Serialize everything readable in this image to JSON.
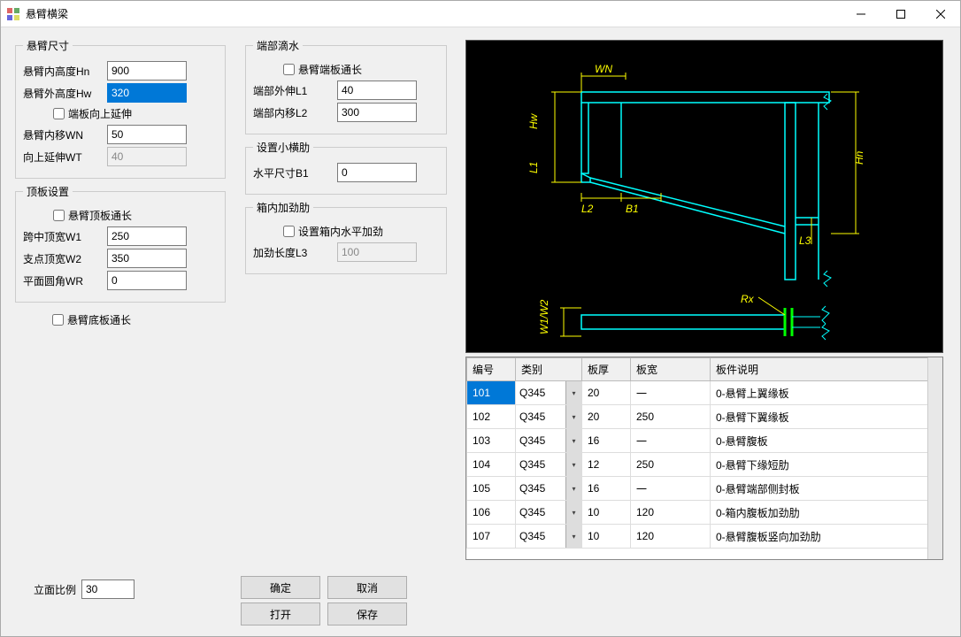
{
  "window": {
    "title": "悬臂横梁"
  },
  "winbtns": {
    "close_tip": "Close"
  },
  "arm_size": {
    "legend": "悬臂尺寸",
    "hn_label": "悬臂内高度Hn",
    "hn_value": "900",
    "hw_label": "悬臂外高度Hw",
    "hw_value": "320",
    "ext_up_label": "端板向上延伸",
    "ext_up_checked": false,
    "wn_label": "悬臂内移WN",
    "wn_value": "50",
    "wt_label": "向上延伸WT",
    "wt_value": "40"
  },
  "top_plate": {
    "legend": "顶板设置",
    "full_len_label": "悬臂顶板通长",
    "full_len_checked": false,
    "w1_label": "跨中顶宽W1",
    "w1_value": "250",
    "w2_label": "支点顶宽W2",
    "w2_value": "350",
    "wr_label": "平面圆角WR",
    "wr_value": "0"
  },
  "bot_plate": {
    "full_len_label": "悬臂底板通长",
    "full_len_checked": false
  },
  "drip": {
    "legend": "端部滴水",
    "full_len_label": "悬臂端板通长",
    "full_len_checked": false,
    "l1_label": "端部外伸L1",
    "l1_value": "40",
    "l2_label": "端部内移L2",
    "l2_value": "300"
  },
  "small_rib": {
    "legend": "设置小横肋",
    "b1_label": "水平尺寸B1",
    "b1_value": "0"
  },
  "box_rib": {
    "legend": "箱内加劲肋",
    "enable_label": "设置箱内水平加劲",
    "enable_checked": false,
    "l3_label": "加劲长度L3",
    "l3_value": "100"
  },
  "ratio": {
    "label": "立面比例",
    "value": "30"
  },
  "buttons": {
    "ok": "确定",
    "cancel": "取消",
    "open": "打开",
    "save": "保存"
  },
  "preview": {
    "labels": {
      "WN": "WN",
      "Hw": "Hw",
      "L1": "L1",
      "Hn": "Hn",
      "L2": "L2",
      "B1": "B1",
      "L3": "L3",
      "W1W2": "W1/W2",
      "Rx": "Rx"
    }
  },
  "table": {
    "headers": {
      "id": "编号",
      "cat": "类别",
      "th": "板厚",
      "w": "板宽",
      "desc": "板件说明"
    },
    "rows": [
      {
        "id": "101",
        "cat": "Q345",
        "th": "20",
        "w": "一",
        "desc": "0-悬臂上翼缘板"
      },
      {
        "id": "102",
        "cat": "Q345",
        "th": "20",
        "w": "250",
        "desc": "0-悬臂下翼缘板"
      },
      {
        "id": "103",
        "cat": "Q345",
        "th": "16",
        "w": "一",
        "desc": "0-悬臂腹板"
      },
      {
        "id": "104",
        "cat": "Q345",
        "th": "12",
        "w": "250",
        "desc": "0-悬臂下缘短肋"
      },
      {
        "id": "105",
        "cat": "Q345",
        "th": "16",
        "w": "一",
        "desc": "0-悬臂端部侧封板"
      },
      {
        "id": "106",
        "cat": "Q345",
        "th": "10",
        "w": "120",
        "desc": "0-箱内腹板加劲肋"
      },
      {
        "id": "107",
        "cat": "Q345",
        "th": "10",
        "w": "120",
        "desc": "0-悬臂腹板竖向加劲肋"
      }
    ],
    "sel": 0
  }
}
